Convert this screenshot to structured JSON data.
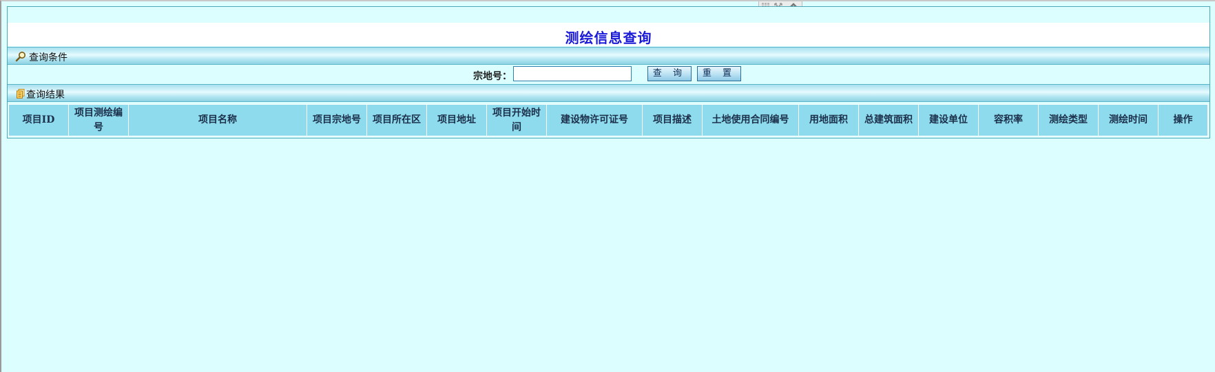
{
  "window_controls": [
    {
      "name": "grid-icon"
    },
    {
      "name": "expand-icon"
    },
    {
      "name": "collapse-chevron-icon"
    }
  ],
  "page": {
    "title": "测绘信息查询"
  },
  "query_section": {
    "header": "查询条件",
    "icon": "magnifier-icon",
    "fields": {
      "parcel_label": "宗地号：",
      "parcel_value": "",
      "parcel_placeholder": ""
    },
    "buttons": {
      "query": "查 询",
      "reset": "重 置"
    }
  },
  "results_section": {
    "header": "查询结果",
    "icon": "document-icon",
    "columns": [
      "项目ID",
      "项目测绘编号",
      "项目名称",
      "项目宗地号",
      "项目所在区",
      "项目地址",
      "项目开始时间",
      "建设物许可证号",
      "项目描述",
      "土地使用合同编号",
      "用地面积",
      "总建筑面积",
      "建设单位",
      "容积率",
      "测绘类型",
      "测绘时间",
      "操作"
    ],
    "rows": []
  },
  "colors": {
    "background": "#dcfefe",
    "title": "#1a1ad6",
    "table_header": "#8edbed",
    "border": "#4aa8b8"
  }
}
